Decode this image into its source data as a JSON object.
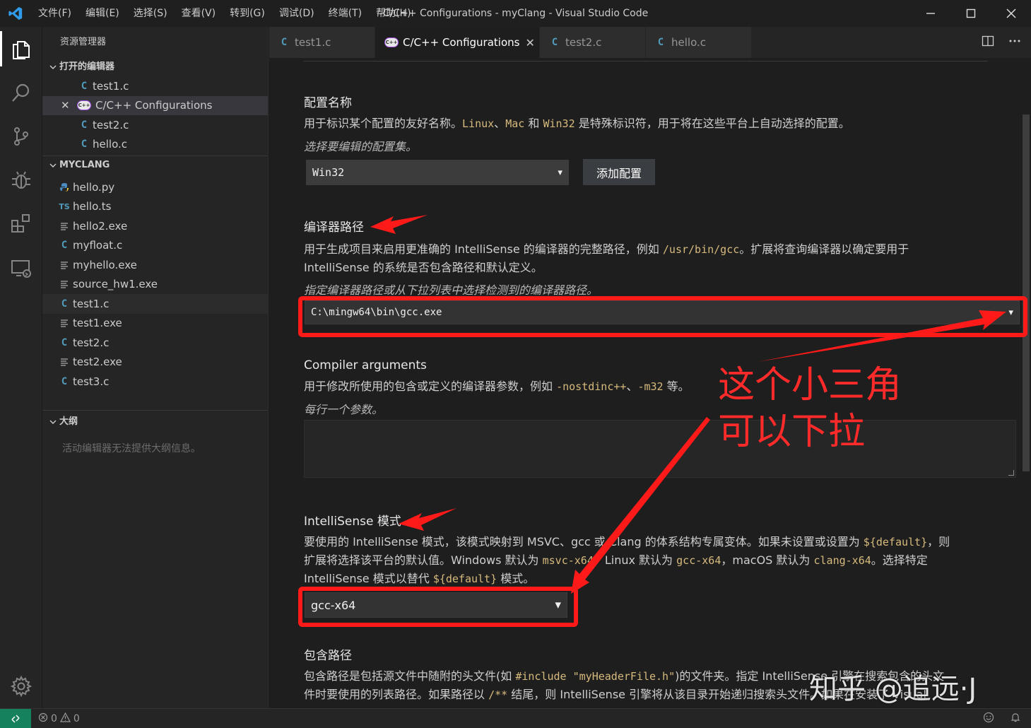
{
  "window": {
    "title": "C/C++ Configurations - myClang - Visual Studio Code",
    "menu": [
      "文件(F)",
      "编辑(E)",
      "选择(S)",
      "查看(V)",
      "转到(G)",
      "调试(D)",
      "终端(T)",
      "帮助(H)"
    ]
  },
  "sidebar": {
    "title": "资源管理器",
    "open_editors": {
      "label": "打开的编辑器",
      "items": [
        {
          "name": "test1.c",
          "icon": "C"
        },
        {
          "name": "C/C++ Configurations",
          "icon": "C++"
        },
        {
          "name": "test2.c",
          "icon": "C"
        },
        {
          "name": "hello.c",
          "icon": "C"
        }
      ]
    },
    "workspace": {
      "label": "MYCLANG",
      "files": [
        {
          "name": "hello.py",
          "icon": "python-icon"
        },
        {
          "name": "hello.ts",
          "icon": "TS"
        },
        {
          "name": "hello2.exe",
          "icon": "file-lines-icon"
        },
        {
          "name": "myfloat.c",
          "icon": "C"
        },
        {
          "name": "myhello.exe",
          "icon": "file-lines-icon"
        },
        {
          "name": "source_hw1.exe",
          "icon": "file-lines-icon"
        },
        {
          "name": "test1.c",
          "icon": "C"
        },
        {
          "name": "test1.exe",
          "icon": "file-lines-icon"
        },
        {
          "name": "test2.c",
          "icon": "C"
        },
        {
          "name": "test2.exe",
          "icon": "file-lines-icon"
        },
        {
          "name": "test3.c",
          "icon": "C"
        }
      ]
    },
    "outline": {
      "label": "大纲",
      "empty": "活动编辑器无法提供大纲信息。"
    }
  },
  "tabs": [
    {
      "label": "test1.c",
      "icon": "C"
    },
    {
      "label": "C/C++ Configurations",
      "icon": "C++"
    },
    {
      "label": "test2.c",
      "icon": "C"
    },
    {
      "label": "hello.c",
      "icon": "C"
    }
  ],
  "icons": {
    "c_letter": "C",
    "ts_letter": "TS",
    "cpp_badge": "C++",
    "close": "✕",
    "caret": "▼",
    "chevron": "⌄"
  },
  "config": {
    "name_section": {
      "title": "配置名称",
      "desc_parts": [
        "用于标识某个配置的友好名称。",
        "Linux",
        "、",
        "Mac",
        " 和 ",
        "Win32",
        " 是特殊标识符，用于将在这些平台上自动选择的配置。"
      ],
      "hint": "选择要编辑的配置集。",
      "selected": "Win32",
      "add_button": "添加配置"
    },
    "compiler_path": {
      "title": "编译器路径",
      "desc_line1_parts": [
        "用于生成项目来启用更准确的 IntelliSense 的编译器的完整路径，例如 ",
        "/usr/bin/gcc",
        "。扩展将查询编译器以确定要用于"
      ],
      "desc_line2": "IntelliSense 的系统是否包含路径和默认定义。",
      "hint": "指定编译器路径或从下拉列表中选择检测到的编译器路径。",
      "value": "C:\\mingw64\\bin\\gcc.exe"
    },
    "compiler_args": {
      "title": "Compiler arguments",
      "desc_parts": [
        "用于修改所使用的包含或定义的编译器参数，例如 ",
        "-nostdinc++",
        "、",
        "-m32",
        " 等。"
      ],
      "hint": "每行一个参数。"
    },
    "intellisense": {
      "title": "IntelliSense 模式",
      "line1_parts": [
        "要使用的 IntelliSense 模式，该模式映射到 MSVC、gcc 或 Clang 的体系结构专属变体。如果未设置或设置为 ",
        "${default}",
        "，则"
      ],
      "line2_parts": [
        "扩展将选择该平台的默认值。Windows 默认为 ",
        "msvc-x64",
        "，Linux 默认为 ",
        "gcc-x64",
        "，macOS 默认为 ",
        "clang-x64",
        "。选择特定"
      ],
      "line3_parts": [
        "IntelliSense 模式以替代 ",
        "${default}",
        " 模式。"
      ],
      "value": "gcc-x64"
    },
    "include_path": {
      "title": "包含路径",
      "line1_parts": [
        "包含路径是包括源文件中随附的头文件(如 ",
        "#include \"myHeaderFile.h\"",
        ")的文件夹。指定 IntelliSense 引擎在搜索包含的头文"
      ],
      "line2_parts": [
        "件时要使用的列表路径。如果路径以 ",
        "/**",
        " 结尾，则 IntelliSense 引擎将从该目录开始递归搜索头文件。如果在安装了 Visual"
      ]
    }
  },
  "annotation": {
    "line1": "这个小三角",
    "line2": "可以下拉",
    "color": "#ff1a1a"
  },
  "watermark": "知乎 @追远·J",
  "status": {
    "errors": "0",
    "warnings": "0"
  }
}
